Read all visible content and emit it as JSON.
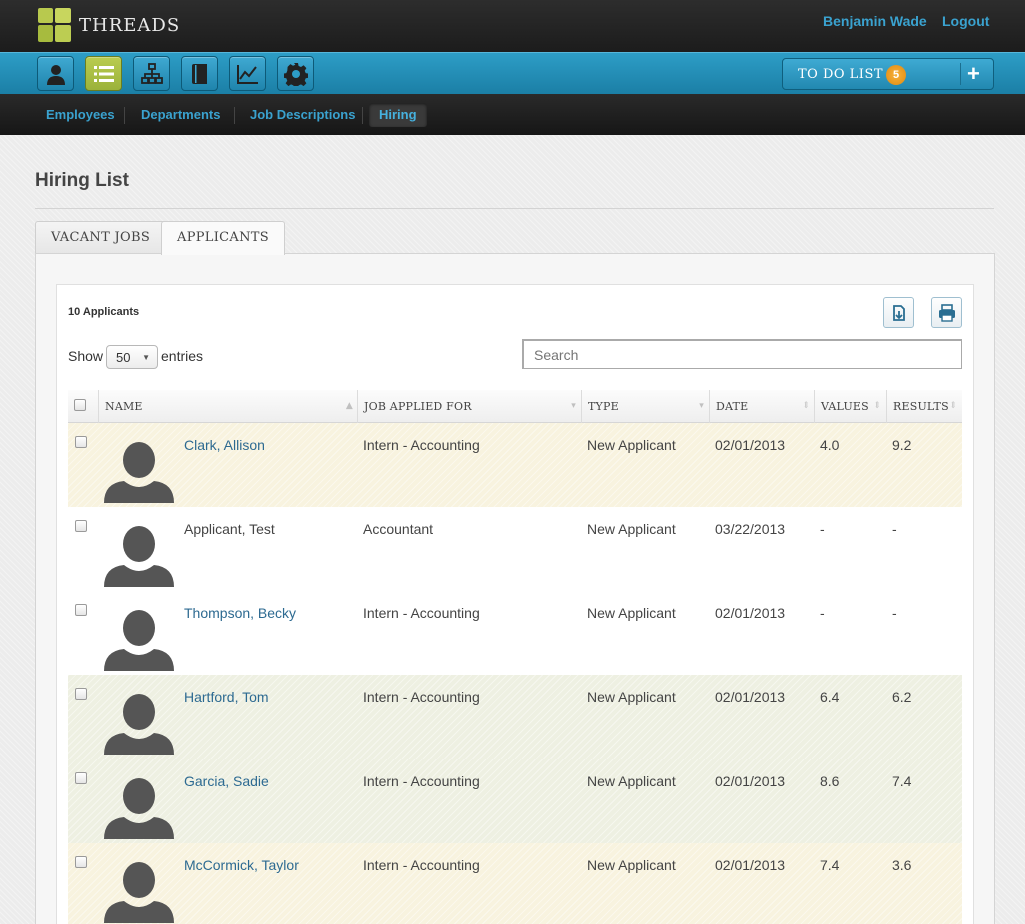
{
  "app": {
    "brand": "THREADS"
  },
  "user": {
    "name": "Benjamin Wade",
    "logout": "Logout"
  },
  "toolbar": {
    "icons": [
      "person-icon",
      "list-icon",
      "org-chart-icon",
      "book-icon",
      "chart-icon",
      "gear-icon"
    ],
    "active": "list-icon",
    "todo_label": "TO DO LIST",
    "todo_count": "5",
    "todo_add": "+"
  },
  "subnav": {
    "items": [
      "Employees",
      "Departments",
      "Job Descriptions",
      "Hiring"
    ],
    "active": "Hiring"
  },
  "page": {
    "title": "Hiring List",
    "tabs": [
      "VACANT JOBS",
      "APPLICANTS"
    ],
    "active_tab": "APPLICANTS"
  },
  "list": {
    "count_label": "10 Applicants",
    "show_label": "Show",
    "entries_label": "entries",
    "page_size": "50",
    "search_placeholder": "Search",
    "columns": [
      "NAME",
      "JOB APPLIED FOR",
      "TYPE",
      "DATE",
      "VALUES",
      "RESULTS"
    ],
    "rows": [
      {
        "name": "Clark, Allison",
        "job": "Intern - Accounting",
        "type": "New Applicant",
        "date": "02/01/2013",
        "values": "4.0",
        "results": "9.2",
        "link": true,
        "tint": "tan"
      },
      {
        "name": "Applicant, Test",
        "job": "Accountant",
        "type": "New Applicant",
        "date": "03/22/2013",
        "values": "-",
        "results": "-",
        "link": false,
        "tint": "white"
      },
      {
        "name": "Thompson, Becky",
        "job": "Intern - Accounting",
        "type": "New Applicant",
        "date": "02/01/2013",
        "values": "-",
        "results": "-",
        "link": true,
        "tint": "white"
      },
      {
        "name": "Hartford, Tom",
        "job": "Intern - Accounting",
        "type": "New Applicant",
        "date": "02/01/2013",
        "values": "6.4",
        "results": "6.2",
        "link": true,
        "tint": "green"
      },
      {
        "name": "Garcia, Sadie",
        "job": "Intern - Accounting",
        "type": "New Applicant",
        "date": "02/01/2013",
        "values": "8.6",
        "results": "7.4",
        "link": true,
        "tint": "green"
      },
      {
        "name": "McCormick, Taylor",
        "job": "Intern - Accounting",
        "type": "New Applicant",
        "date": "02/01/2013",
        "values": "7.4",
        "results": "3.6",
        "link": true,
        "tint": "tan"
      }
    ]
  },
  "colors": {
    "accent_blue": "#2d9dc6",
    "link": "#3aa2cf",
    "active_green": "#b9cc50",
    "row_tan": "#f8f3df",
    "row_green": "#eef0e2",
    "badge_orange": "#e08a10"
  }
}
